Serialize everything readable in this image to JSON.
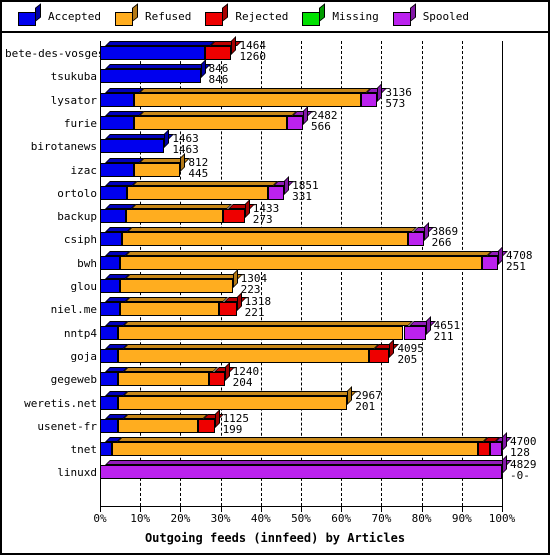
{
  "legend": {
    "items": [
      {
        "label": "Accepted",
        "color": "#0000ee",
        "icon": "cube-icon"
      },
      {
        "label": "Refused",
        "color": "#ffad1f",
        "icon": "cube-icon"
      },
      {
        "label": "Rejected",
        "color": "#ee0000",
        "icon": "cube-icon"
      },
      {
        "label": "Missing",
        "color": "#00e000",
        "icon": "cube-icon"
      },
      {
        "label": "Spooled",
        "color": "#bb22ee",
        "icon": "cube-icon"
      }
    ]
  },
  "chart_data": {
    "type": "bar",
    "orientation": "horizontal",
    "stacked": true,
    "title": "Outgoing feeds (innfeed) by Articles",
    "xlabel": "Outgoing feeds (innfeed) by Articles",
    "ylabel": "",
    "xlim": [
      0,
      100
    ],
    "xunit": "%",
    "grid": true,
    "legend_position": "top",
    "xticks": [
      "0%",
      "10%",
      "20%",
      "30%",
      "40%",
      "50%",
      "60%",
      "70%",
      "80%",
      "90%",
      "100%"
    ],
    "xtickvalues": [
      0,
      10,
      20,
      30,
      40,
      50,
      60,
      70,
      80,
      90,
      100
    ],
    "series": [
      {
        "name": "Accepted",
        "color": "#0000ee"
      },
      {
        "name": "Refused",
        "color": "#ffad1f"
      },
      {
        "name": "Rejected",
        "color": "#ee0000"
      },
      {
        "name": "Missing",
        "color": "#00e000"
      },
      {
        "name": "Spooled",
        "color": "#bb22ee"
      }
    ],
    "categories": [
      "bete-des-vosges",
      "tsukuba",
      "lysator",
      "furie",
      "birotanews",
      "izac",
      "ortolo",
      "backup",
      "csiph",
      "bwh",
      "glou",
      "niel.me",
      "nntp4",
      "goja",
      "gegeweb",
      "weretis.net",
      "usenet-fr",
      "tnet",
      "linuxd"
    ],
    "rows": [
      {
        "label": "bete-des-vosges",
        "label_top": "1464",
        "label_bottom": "1260",
        "segments": [
          {
            "series": "Accepted",
            "pct": 26.0
          },
          {
            "series": "Rejected",
            "pct": 6.7
          }
        ]
      },
      {
        "label": "tsukuba",
        "label_top": "846",
        "label_bottom": "846",
        "segments": [
          {
            "series": "Accepted",
            "pct": 25.0
          }
        ]
      },
      {
        "label": "lysator",
        "label_top": "3136",
        "label_bottom": "573",
        "segments": [
          {
            "series": "Accepted",
            "pct": 8.5
          },
          {
            "series": "Refused",
            "pct": 56.5
          },
          {
            "series": "Spooled",
            "pct": 4.0
          }
        ]
      },
      {
        "label": "furie",
        "label_top": "2482",
        "label_bottom": "566",
        "segments": [
          {
            "series": "Accepted",
            "pct": 8.5
          },
          {
            "series": "Refused",
            "pct": 38.0
          },
          {
            "series": "Spooled",
            "pct": 4.0
          }
        ]
      },
      {
        "label": "birotanews",
        "label_top": "1463",
        "label_bottom": "1463",
        "segments": [
          {
            "series": "Accepted",
            "pct": 16.0
          }
        ]
      },
      {
        "label": "izac",
        "label_top": "812",
        "label_bottom": "445",
        "segments": [
          {
            "series": "Accepted",
            "pct": 8.5
          },
          {
            "series": "Refused",
            "pct": 11.5
          }
        ]
      },
      {
        "label": "ortolo",
        "label_top": "1851",
        "label_bottom": "331",
        "segments": [
          {
            "series": "Accepted",
            "pct": 6.8
          },
          {
            "series": "Refused",
            "pct": 35.0
          },
          {
            "series": "Spooled",
            "pct": 4.0
          }
        ]
      },
      {
        "label": "backup",
        "label_top": "1433",
        "label_bottom": "273",
        "segments": [
          {
            "series": "Accepted",
            "pct": 6.5
          },
          {
            "series": "Refused",
            "pct": 24.0
          },
          {
            "series": "Rejected",
            "pct": 5.5
          }
        ]
      },
      {
        "label": "csiph",
        "label_top": "3869",
        "label_bottom": "266",
        "segments": [
          {
            "series": "Accepted",
            "pct": 5.5
          },
          {
            "series": "Refused",
            "pct": 71.0
          },
          {
            "series": "Spooled",
            "pct": 4.0
          }
        ]
      },
      {
        "label": "bwh",
        "label_top": "4708",
        "label_bottom": "251",
        "segments": [
          {
            "series": "Accepted",
            "pct": 5.0
          },
          {
            "series": "Refused",
            "pct": 90.0
          },
          {
            "series": "Spooled",
            "pct": 4.0
          }
        ]
      },
      {
        "label": "glou",
        "label_top": "1304",
        "label_bottom": "223",
        "segments": [
          {
            "series": "Accepted",
            "pct": 5.0
          },
          {
            "series": "Refused",
            "pct": 28.0
          }
        ]
      },
      {
        "label": "niel.me",
        "label_top": "1318",
        "label_bottom": "221",
        "segments": [
          {
            "series": "Accepted",
            "pct": 5.0
          },
          {
            "series": "Refused",
            "pct": 24.5
          },
          {
            "series": "Rejected",
            "pct": 4.5
          }
        ]
      },
      {
        "label": "nntp4",
        "label_top": "4651",
        "label_bottom": "211",
        "segments": [
          {
            "series": "Accepted",
            "pct": 4.5
          },
          {
            "series": "Refused",
            "pct": 71.0
          },
          {
            "series": "Spooled",
            "pct": 5.5
          }
        ]
      },
      {
        "label": "goja",
        "label_top": "4095",
        "label_bottom": "205",
        "segments": [
          {
            "series": "Accepted",
            "pct": 4.5
          },
          {
            "series": "Refused",
            "pct": 62.5
          },
          {
            "series": "Rejected",
            "pct": 5.0
          }
        ]
      },
      {
        "label": "gegeweb",
        "label_top": "1240",
        "label_bottom": "204",
        "segments": [
          {
            "series": "Accepted",
            "pct": 4.5
          },
          {
            "series": "Refused",
            "pct": 22.5
          },
          {
            "series": "Rejected",
            "pct": 4.0
          }
        ]
      },
      {
        "label": "weretis.net",
        "label_top": "2967",
        "label_bottom": "201",
        "segments": [
          {
            "series": "Accepted",
            "pct": 4.5
          },
          {
            "series": "Refused",
            "pct": 57.0
          }
        ]
      },
      {
        "label": "usenet-fr",
        "label_top": "1125",
        "label_bottom": "199",
        "segments": [
          {
            "series": "Accepted",
            "pct": 4.5
          },
          {
            "series": "Refused",
            "pct": 20.0
          },
          {
            "series": "Rejected",
            "pct": 4.0
          }
        ]
      },
      {
        "label": "tnet",
        "label_top": "4700",
        "label_bottom": "128",
        "segments": [
          {
            "series": "Accepted",
            "pct": 3.0
          },
          {
            "series": "Refused",
            "pct": 91.0
          },
          {
            "series": "Rejected",
            "pct": 3.0
          },
          {
            "series": "Spooled",
            "pct": 3.0
          }
        ]
      },
      {
        "label": "linuxd",
        "label_top": "4829",
        "label_bottom": "-0-",
        "segments": [
          {
            "series": "Spooled",
            "pct": 100.0
          }
        ]
      }
    ]
  }
}
